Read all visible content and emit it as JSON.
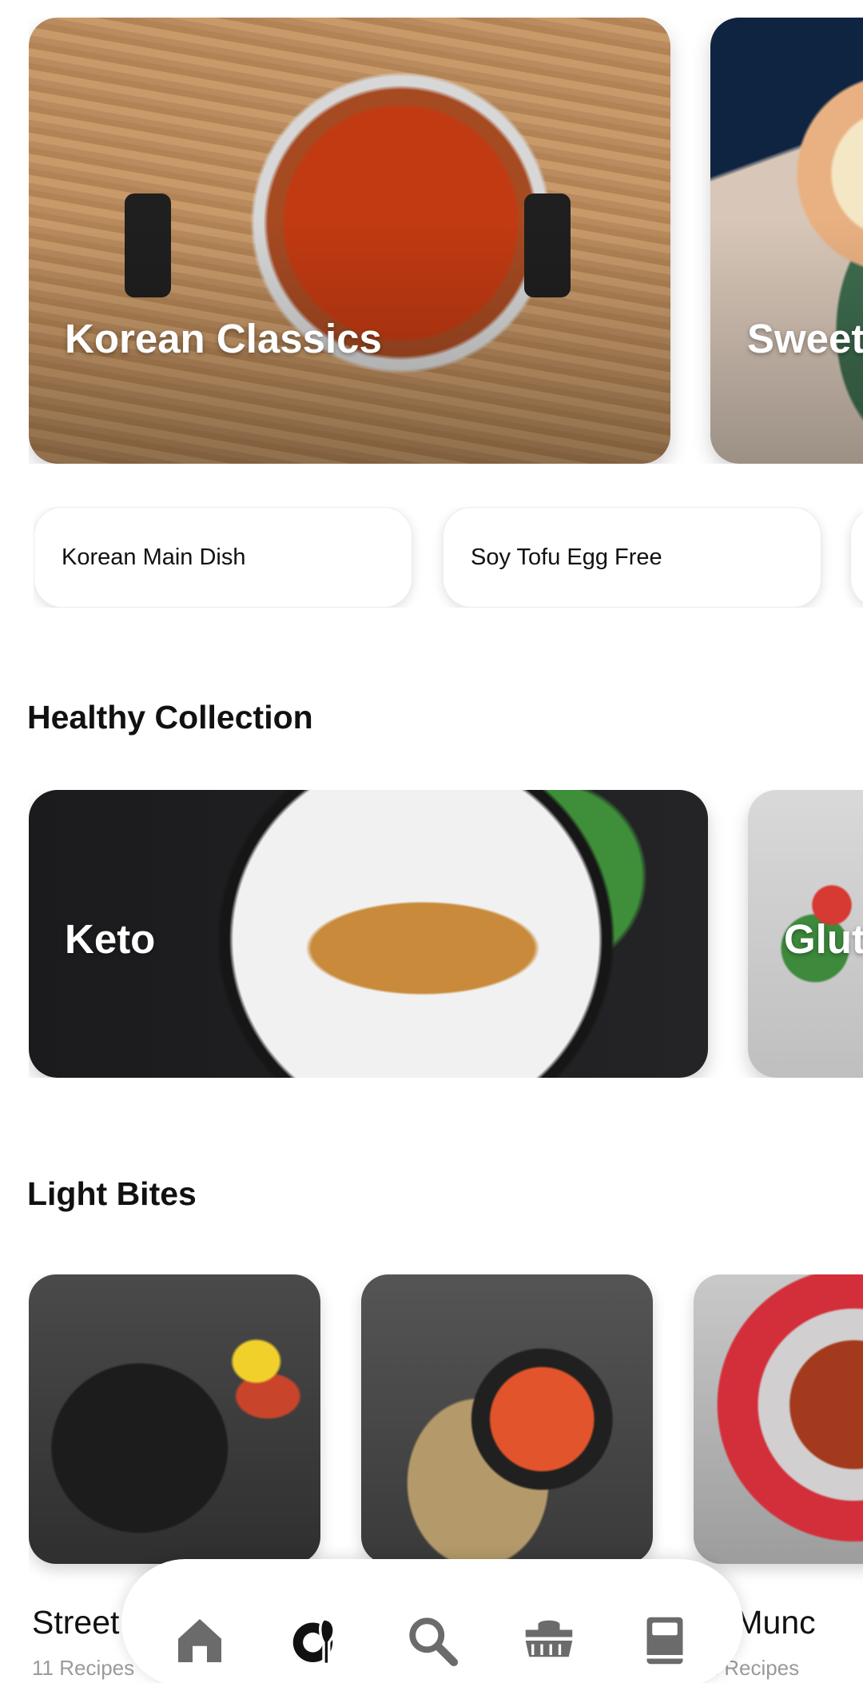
{
  "hero": {
    "cards": [
      {
        "title": "Korean Classics"
      },
      {
        "title": "Sweet"
      }
    ]
  },
  "chips": [
    {
      "label": "Korean Main Dish"
    },
    {
      "label": "Soy Tofu Egg Free"
    }
  ],
  "healthy": {
    "heading": "Healthy Collection",
    "cards": [
      {
        "title": "Keto"
      },
      {
        "title": "Glut"
      }
    ]
  },
  "light_bites": {
    "heading": "Light Bites",
    "items": [
      {
        "name": "Street",
        "sub": "11 Recipes"
      },
      {
        "name": "",
        "sub": ""
      },
      {
        "name": "sy Munc",
        "sub": "11 Recipes"
      }
    ]
  },
  "nav": {
    "items": [
      {
        "icon": "home-icon",
        "active": false
      },
      {
        "icon": "recipes-icon",
        "active": true
      },
      {
        "icon": "search-icon",
        "active": false
      },
      {
        "icon": "meal-plan-icon",
        "active": false
      },
      {
        "icon": "cookbook-icon",
        "active": false
      }
    ],
    "colors": {
      "inactive": "#6b6b6b",
      "active": "#111111"
    }
  }
}
